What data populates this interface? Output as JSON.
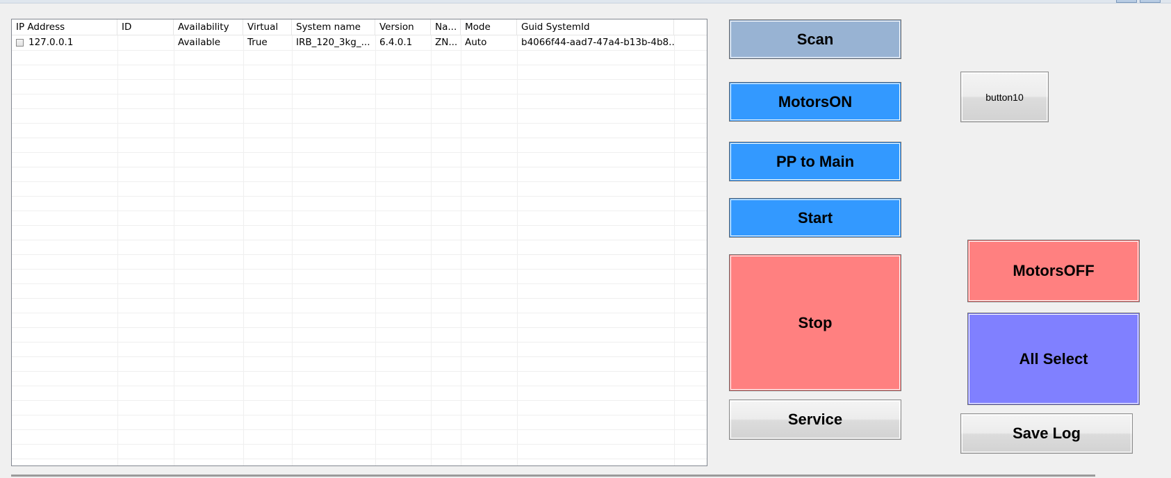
{
  "list": {
    "columns": [
      "IP Address",
      "ID",
      "Availability",
      "Virtual",
      "System name",
      "Version",
      "Na...",
      "Mode",
      "Guid SystemId"
    ],
    "rows": [
      {
        "checked": false,
        "ip": "127.0.0.1",
        "id": "",
        "availability": "Available",
        "virtual": "True",
        "system_name": "IRB_120_3kg_...",
        "version": "6.4.0.1",
        "name": "ZN...",
        "mode": "Auto",
        "guid": "b4066f44-aad7-47a4-b13b-4b8..."
      }
    ]
  },
  "buttons": {
    "scan": "Scan",
    "motors_on": "MotorsON",
    "pp_to_main": "PP to Main",
    "start": "Start",
    "stop": "Stop",
    "service": "Service",
    "button10": "button10",
    "motors_off": "MotorsOFF",
    "all_select": "All Select",
    "save_log": "Save Log"
  },
  "colors": {
    "scan": "#98b3d3",
    "blue": "#3399ff",
    "red": "#ff8080",
    "purple": "#8080ff"
  }
}
